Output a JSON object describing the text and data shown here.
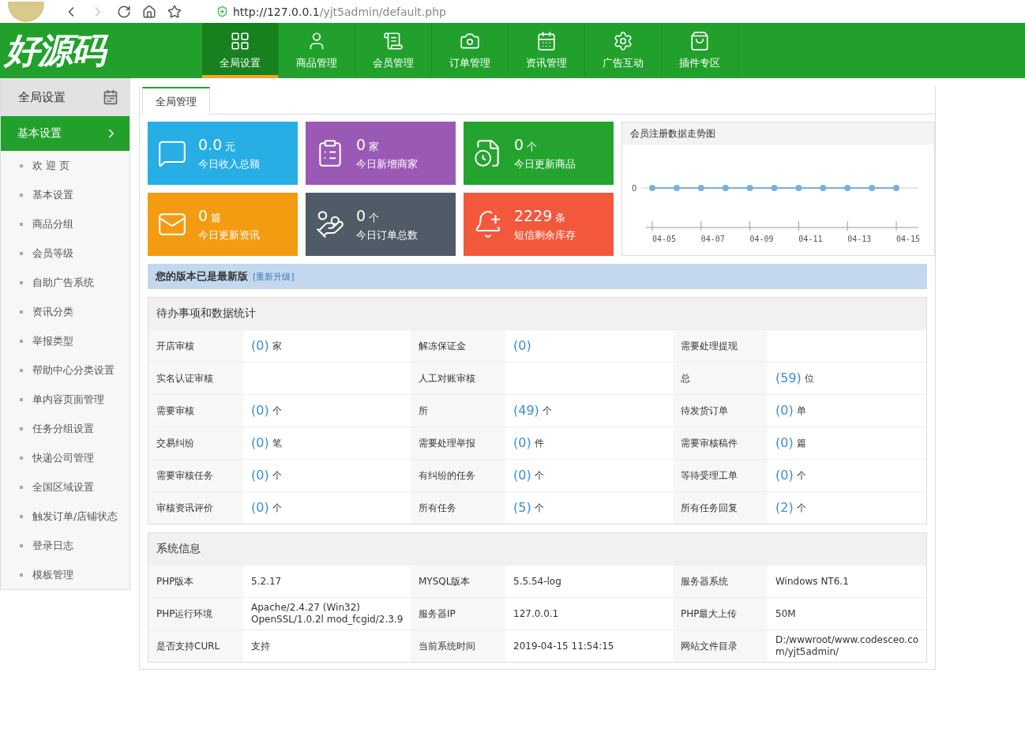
{
  "browser": {
    "url_host": "http://127.0.0.1",
    "url_path": "/yjt5admin/default.php"
  },
  "header": {
    "logo": "好源码",
    "nav": [
      {
        "label": "全局设置",
        "selected": true
      },
      {
        "label": "商品管理",
        "selected": false
      },
      {
        "label": "会员管理",
        "selected": false
      },
      {
        "label": "订单管理",
        "selected": false
      },
      {
        "label": "资讯管理",
        "selected": false
      },
      {
        "label": "广告互动",
        "selected": false
      },
      {
        "label": "插件专区",
        "selected": false
      }
    ]
  },
  "sidebar": {
    "title": "全局设置",
    "section": {
      "label": "基本设置",
      "expanded": true
    },
    "items": [
      "欢 迎 页",
      "基本设置",
      "商品分组",
      "会员等级",
      "自助广告系统",
      "资讯分类",
      "举报类型",
      "帮助中心分类设置",
      "单内容页面管理",
      "任务分组设置",
      "快递公司管理",
      "全国区域设置",
      "触发订单/店铺状态",
      "登录日志",
      "模板管理"
    ]
  },
  "tab": {
    "label": "全局管理",
    "selected": true
  },
  "stats": [
    {
      "value": "0.0",
      "unit": "元",
      "label": "今日收入总额",
      "color": "#27aee4"
    },
    {
      "value": "0",
      "unit": "家",
      "label": "今日新增商家",
      "color": "#9b59b6"
    },
    {
      "value": "0",
      "unit": "个",
      "label": "今日更新商品",
      "color": "#24a42f"
    },
    {
      "value": "0",
      "unit": "篇",
      "label": "今日更新资讯",
      "color": "#f39c12"
    },
    {
      "value": "0",
      "unit": "个",
      "label": "今日订单总数",
      "color": "#4f5b66"
    },
    {
      "value": "2229",
      "unit": "条",
      "label": "短信剩余库存",
      "color": "#f4583c"
    }
  ],
  "trend": {
    "title": "会员注册数据走势图",
    "axis_label": "0",
    "date_labels": [
      "04-05",
      "04-07",
      "04-09",
      "04-11",
      "04-13",
      "04-15"
    ]
  },
  "version": {
    "text": "您的版本已是最新版",
    "link": "[重新升级]"
  },
  "todo": {
    "title": "待办事项和数据统计",
    "rows": [
      [
        {
          "label": "开店审核",
          "count": "(0)",
          "unit": "家"
        },
        {
          "label": "解冻保证金",
          "count": "(0)"
        },
        {
          "label": "需要处理提现"
        }
      ],
      [
        {
          "label": "实名认证审核"
        },
        {
          "label": "人工对账审核"
        },
        {
          "label": "总",
          "count": "(59)",
          "unit": "位"
        }
      ],
      [
        {
          "label": "需要审核",
          "count": "(0)",
          "unit": "个"
        },
        {
          "label": "所",
          "count": "(49)",
          "unit": "个"
        },
        {
          "label": "待发货订单",
          "count": "(0)",
          "unit": "单"
        }
      ],
      [
        {
          "label": "交易纠纷",
          "count": "(0)",
          "unit": "笔"
        },
        {
          "label": "需要处理举报",
          "count": "(0)",
          "unit": "件"
        },
        {
          "label": "需要审核稿件",
          "count": "(0)",
          "unit": "篇"
        }
      ],
      [
        {
          "label": "需要审核任务",
          "count": "(0)",
          "unit": "个"
        },
        {
          "label": "有纠纷的任务",
          "count": "(0)",
          "unit": "个"
        },
        {
          "label": "等待受理工单",
          "count": "(0)",
          "unit": "个"
        }
      ],
      [
        {
          "label": "审核资讯评价",
          "count": "(0)",
          "unit": "个"
        },
        {
          "label": "所有任务",
          "count": "(5)",
          "unit": "个"
        },
        {
          "label": "所有任务回复",
          "count": "(2)",
          "unit": "个"
        }
      ]
    ]
  },
  "system": {
    "title": "系统信息",
    "rows": [
      [
        {
          "label": "PHP版本",
          "value": "5.2.17"
        },
        {
          "label": "MYSQL版本",
          "value": "5.5.54-log"
        },
        {
          "label": "服务器系统",
          "value": "Windows NT6.1"
        }
      ],
      [
        {
          "label": "PHP运行环境",
          "value": "Apache/2.4.27 (Win32) OpenSSL/1.0.2l mod_fcgid/2.3.9"
        },
        {
          "label": "服务器IP",
          "value": "127.0.0.1"
        },
        {
          "label": "PHP最大上传",
          "value": "50M"
        }
      ],
      [
        {
          "label": "是否支持CURL",
          "value": "支持"
        },
        {
          "label": "当前系统时间",
          "value": "2019-04-15 11:54:15"
        },
        {
          "label": "网站文件目录",
          "value": "D:/wwwroot/www.codesceo.com/yjt5admin/"
        }
      ]
    ]
  }
}
